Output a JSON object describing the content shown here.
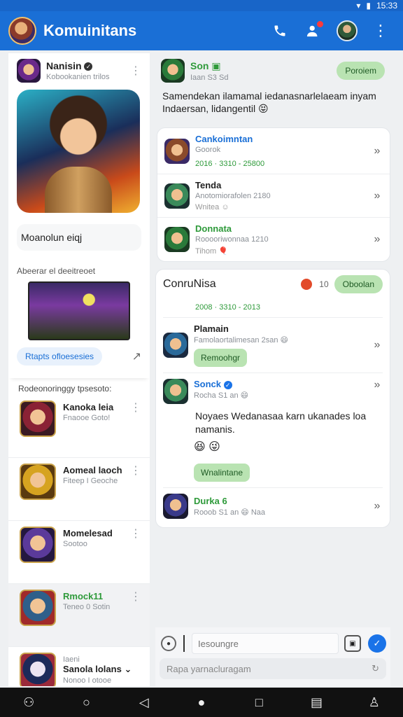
{
  "status": {
    "time": "15:33"
  },
  "appbar": {
    "title": "Komuinitans"
  },
  "left": {
    "author": {
      "name": "Nanisin",
      "subtitle": "Kobookanien trilos"
    },
    "hero_title": "Moanolun eiqj",
    "section_label": "Abeerar el deeitreoet",
    "thumb_button": "Rtapts ofloesesies",
    "recent_label": "Rodeonoringgy tpsesoto:",
    "items": [
      {
        "name": "Kanoka leia",
        "sub": "Fnaooe Goto!",
        "verified": false
      },
      {
        "name": "Aomeal laoch",
        "sub": "Fiteep I Geoche",
        "verified": false
      },
      {
        "name": "Momelesad",
        "sub": "Sootoo",
        "verified": false
      },
      {
        "name": "Rmock11",
        "sub": "Teneo 0  Sotin",
        "verified": false
      },
      {
        "name": "Sanola lolans",
        "sub": "Nonoo I otooe",
        "extra": "Iaeni",
        "verified": false
      }
    ]
  },
  "right": {
    "post": {
      "author": "Son",
      "meta": "Iaan  S3  Sd",
      "chip": "Poroiem",
      "text": "Samendekan ilamamal iedanasnarlelaeam inyam Indaersan, lidangentil"
    },
    "thread": [
      {
        "name": "Cankoimntan",
        "sub": "Goorok",
        "date": "2016 · 3310 - 25800",
        "name_color": "blue"
      },
      {
        "name": "Tenda",
        "sub": "Anotomiorafolen 2180",
        "meta": "Wnitea",
        "name_color": "dark"
      },
      {
        "name": "Donnata",
        "sub": "Rooooriwonnaa 1210",
        "meta": "Tihom",
        "name_color": "green"
      }
    ],
    "community": {
      "title": "ConruNisa",
      "count": "10",
      "chip": "Oboolan",
      "date": "2008 · 3310 - 2013"
    },
    "replies": [
      {
        "name": "Plamain",
        "sub": "Famolaortalimesan 2san",
        "button": "Remoohgr"
      },
      {
        "name": "Sonck",
        "sub": "Rocha  S1 an",
        "text": "Noyaes Wedanasaa karn ukanades loa namanis.",
        "button": "Wnalintane"
      },
      {
        "name": "Durka 6",
        "sub": "Rooob  S1 an",
        "meta": "Naa",
        "name_color": "green"
      }
    ]
  },
  "composer": {
    "placeholder": "Iesoungre",
    "second_placeholder": "Rapa yarnacluragam"
  },
  "navbar": {
    "icons": [
      "people-icon",
      "search-icon",
      "back-icon",
      "home-icon",
      "recents-icon",
      "menu-icon",
      "profile-icon"
    ]
  }
}
